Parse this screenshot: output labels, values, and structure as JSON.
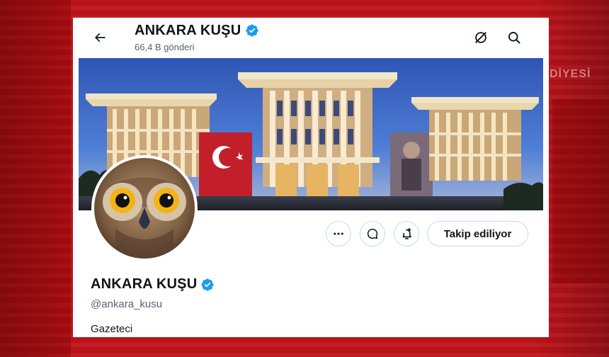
{
  "header": {
    "display_name": "ANKARA KUŞU",
    "post_count": "66,4 B gönderi"
  },
  "profile": {
    "display_name": "ANKARA KUŞU",
    "handle": "@ankara_kusu",
    "bio": "Gazeteci",
    "verified": true
  },
  "actions": {
    "follow_label": "Takip ediliyor"
  },
  "background_sign": "DİYESİ",
  "icons": {
    "back": "arrow-left-icon",
    "grok": "grok-icon",
    "search": "search-icon",
    "verified": "verified-badge-icon",
    "more": "more-icon",
    "message": "message-icon",
    "notify": "bell-plus-icon"
  },
  "colors": {
    "verified": "#1d9bf0",
    "text": "#0f1419",
    "secondary": "#536471",
    "border": "#cfd9de",
    "background": "#c0141b"
  }
}
